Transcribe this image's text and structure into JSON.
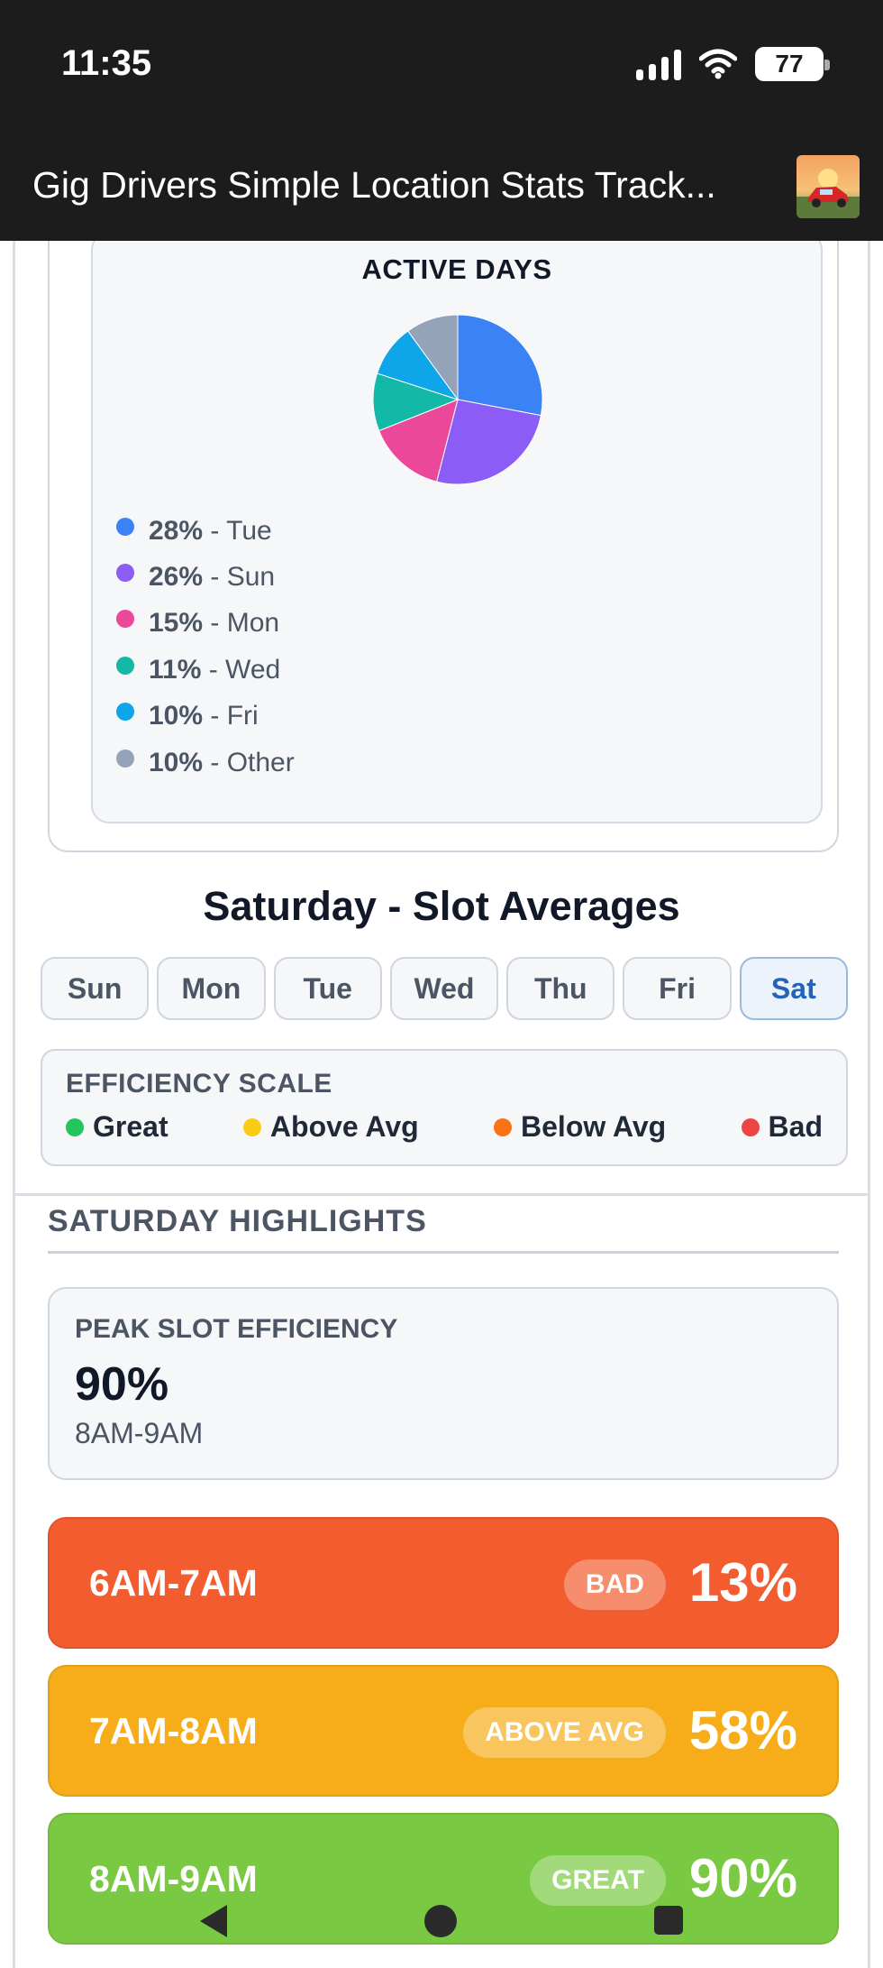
{
  "status_bar": {
    "time": "11:35",
    "battery": "77"
  },
  "app_bar": {
    "title": "Gig Drivers Simple Location Stats Track..."
  },
  "active_days": {
    "title": "ACTIVE DAYS",
    "items": [
      {
        "pct": "28%",
        "label": " - Tue",
        "value": 28,
        "color": "#3b82f6"
      },
      {
        "pct": "26%",
        "label": " - Sun",
        "value": 26,
        "color": "#8b5cf6"
      },
      {
        "pct": "15%",
        "label": " - Mon",
        "value": 15,
        "color": "#ec4899"
      },
      {
        "pct": "11%",
        "label": " - Wed",
        "value": 11,
        "color": "#14b8a6"
      },
      {
        "pct": "10%",
        "label": " - Fri",
        "value": 10,
        "color": "#0ea5e9"
      },
      {
        "pct": "10%",
        "label": " - Other",
        "value": 10,
        "color": "#94a3b8"
      }
    ]
  },
  "section_title": "Saturday - Slot Averages",
  "day_tabs": [
    "Sun",
    "Mon",
    "Tue",
    "Wed",
    "Thu",
    "Fri",
    "Sat"
  ],
  "selected_day": "Sat",
  "efficiency_scale": {
    "title": "EFFICIENCY SCALE",
    "items": [
      {
        "label": "Great",
        "color": "#22c55e"
      },
      {
        "label": "Above Avg",
        "color": "#facc15"
      },
      {
        "label": "Below Avg",
        "color": "#f97316"
      },
      {
        "label": "Bad",
        "color": "#ef4444"
      }
    ]
  },
  "highlights": {
    "title": "SATURDAY HIGHLIGHTS",
    "peak": {
      "label": "PEAK SLOT EFFICIENCY",
      "value": "90%",
      "slot": "8AM-9AM"
    }
  },
  "slots": [
    {
      "time": "6AM-7AM",
      "badge": "BAD",
      "pct": "13%",
      "color": "#f25c2e"
    },
    {
      "time": "7AM-8AM",
      "badge": "ABOVE AVG",
      "pct": "58%",
      "color": "#f7ad19"
    },
    {
      "time": "8AM-9AM",
      "badge": "GREAT",
      "pct": "90%",
      "color": "#7ac943"
    }
  ]
}
